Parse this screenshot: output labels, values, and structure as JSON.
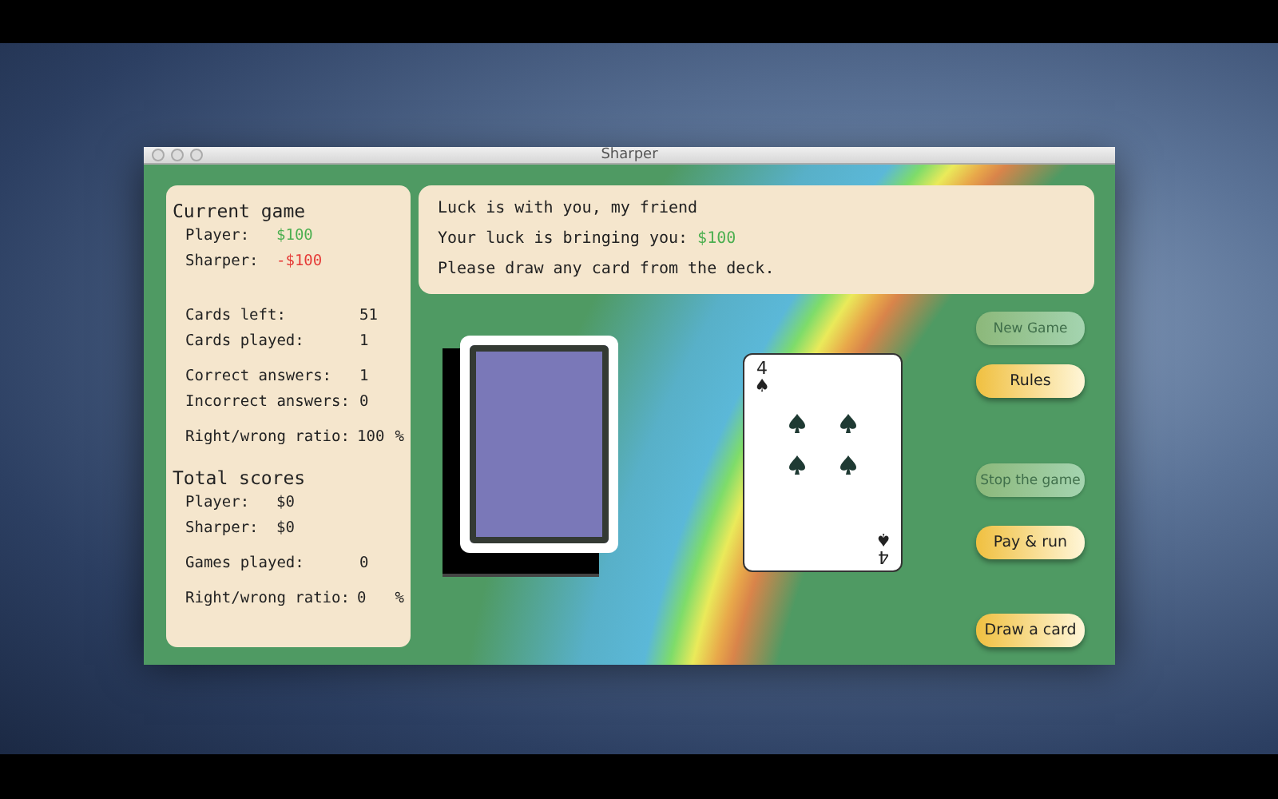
{
  "window": {
    "title": "Sharper"
  },
  "current_game": {
    "heading": "Current game",
    "groups": [
      [
        {
          "label": "Player:",
          "value": "$100",
          "color": "#4caf50"
        },
        {
          "label": "Sharper:",
          "value": "-$100",
          "color": "#e53935"
        }
      ],
      [
        {
          "label": "Cards left:",
          "value": "51",
          "color": "#222222"
        },
        {
          "label": "Cards played:",
          "value": "1",
          "color": "#222222"
        }
      ],
      [
        {
          "label": "Correct answers:",
          "value": "1",
          "color": "#222222"
        },
        {
          "label": "Incorrect answers:",
          "value": "0",
          "color": "#222222"
        }
      ],
      [
        {
          "label": "Right/wrong ratio:",
          "value": "100",
          "unit": "%",
          "color": "#222222"
        }
      ]
    ]
  },
  "total_scores": {
    "heading": "Total scores",
    "groups": [
      [
        {
          "label": "Player:",
          "value": "$0",
          "color": "#222222"
        },
        {
          "label": "Sharper:",
          "value": "$0",
          "color": "#222222"
        }
      ],
      [
        {
          "label": "Games played:",
          "value": "0",
          "color": "#222222"
        }
      ],
      [
        {
          "label": "Right/wrong ratio:",
          "value": "0",
          "unit": "%",
          "color": "#222222"
        }
      ]
    ]
  },
  "messages": [
    {
      "text": "Luck is with you, my friend"
    },
    {
      "text": "Your luck is bringing you:",
      "value": "$100",
      "color": "#4caf50"
    },
    {
      "text": "Please draw any card from the deck."
    }
  ],
  "card": {
    "top_rank": "4",
    "top_suit": "♠",
    "bottom_rank": "4",
    "bottom_suit": "♠"
  },
  "buttons": [
    {
      "label": "New Game",
      "disabled": true
    },
    {
      "label": "Rules",
      "disabled": false
    },
    {
      "label": "Stop the game",
      "disabled": true
    },
    {
      "label": "Pay & run",
      "disabled": false
    },
    {
      "label": "Draw a card",
      "disabled": false
    }
  ]
}
